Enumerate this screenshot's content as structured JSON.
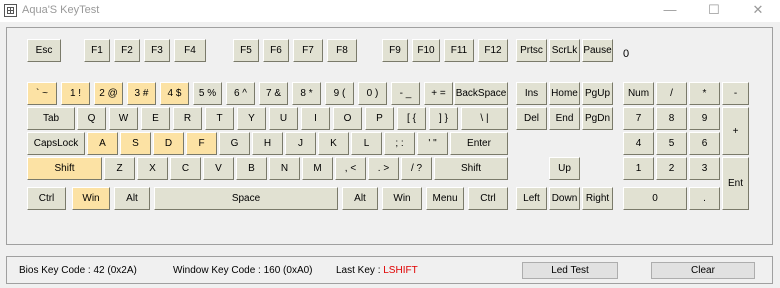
{
  "window": {
    "title": "Aqua'S KeyTest",
    "minimize": "—",
    "maximize": "☐",
    "close": "✕"
  },
  "bios_value": "0",
  "status": {
    "bios_label": "Bios Key Code : 42 (0x2A)",
    "window_label": "Window Key Code : 160 (0xA0)",
    "last_key_label": "Last Key : ",
    "last_key_value": "LSHIFT"
  },
  "buttons": {
    "led_test": "Led Test",
    "clear": "Clear"
  },
  "keys": [
    {
      "label": "Esc",
      "on": false
    },
    {
      "label": "F1",
      "on": false
    },
    {
      "label": "F2",
      "on": false
    },
    {
      "label": "F3",
      "on": false
    },
    {
      "label": "F4",
      "on": false
    },
    {
      "label": "F5",
      "on": false
    },
    {
      "label": "F6",
      "on": false
    },
    {
      "label": "F7",
      "on": false
    },
    {
      "label": "F8",
      "on": false
    },
    {
      "label": "F9",
      "on": false
    },
    {
      "label": "F10",
      "on": false
    },
    {
      "label": "F11",
      "on": false
    },
    {
      "label": "F12",
      "on": false
    },
    {
      "label": "Prtsc",
      "on": false
    },
    {
      "label": "ScrLk",
      "on": false
    },
    {
      "label": "Pause",
      "on": false
    },
    {
      "label": "` ~",
      "on": true
    },
    {
      "label": "1 !",
      "on": true
    },
    {
      "label": "2 @",
      "on": true
    },
    {
      "label": "3 #",
      "on": true
    },
    {
      "label": "4 $",
      "on": true
    },
    {
      "label": "5 %",
      "on": false
    },
    {
      "label": "6 ^",
      "on": false
    },
    {
      "label": "7 &",
      "on": false
    },
    {
      "label": "8 *",
      "on": false
    },
    {
      "label": "9 (",
      "on": false
    },
    {
      "label": "0 )",
      "on": false
    },
    {
      "label": "- _",
      "on": false
    },
    {
      "label": "+ =",
      "on": false
    },
    {
      "label": "BackSpace",
      "on": false
    },
    {
      "label": "Ins",
      "on": false
    },
    {
      "label": "Home",
      "on": false
    },
    {
      "label": "PgUp",
      "on": false
    },
    {
      "label": "Num",
      "on": false
    },
    {
      "label": "/",
      "on": false
    },
    {
      "label": "*",
      "on": false
    },
    {
      "label": "-",
      "on": false
    },
    {
      "label": "Tab",
      "on": false
    },
    {
      "label": "Q",
      "on": false
    },
    {
      "label": "W",
      "on": false
    },
    {
      "label": "E",
      "on": false
    },
    {
      "label": "R",
      "on": false
    },
    {
      "label": "T",
      "on": false
    },
    {
      "label": "Y",
      "on": false
    },
    {
      "label": "U",
      "on": false
    },
    {
      "label": "I",
      "on": false
    },
    {
      "label": "O",
      "on": false
    },
    {
      "label": "P",
      "on": false
    },
    {
      "label": "[ {",
      "on": false
    },
    {
      "label": "] }",
      "on": false
    },
    {
      "label": "\\ |",
      "on": false
    },
    {
      "label": "Del",
      "on": false
    },
    {
      "label": "End",
      "on": false
    },
    {
      "label": "PgDn",
      "on": false
    },
    {
      "label": "7",
      "on": false
    },
    {
      "label": "8",
      "on": false
    },
    {
      "label": "9",
      "on": false
    },
    {
      "label": "+",
      "on": false
    },
    {
      "label": "CapsLock",
      "on": false
    },
    {
      "label": "A",
      "on": true
    },
    {
      "label": "S",
      "on": true
    },
    {
      "label": "D",
      "on": true
    },
    {
      "label": "F",
      "on": true
    },
    {
      "label": "G",
      "on": false
    },
    {
      "label": "H",
      "on": false
    },
    {
      "label": "J",
      "on": false
    },
    {
      "label": "K",
      "on": false
    },
    {
      "label": "L",
      "on": false
    },
    {
      "label": "; :",
      "on": false
    },
    {
      "label": "' \"",
      "on": false
    },
    {
      "label": "Enter",
      "on": false
    },
    {
      "label": "4",
      "on": false
    },
    {
      "label": "5",
      "on": false
    },
    {
      "label": "6",
      "on": false
    },
    {
      "label": "Shift",
      "on": true
    },
    {
      "label": "Z",
      "on": false
    },
    {
      "label": "X",
      "on": false
    },
    {
      "label": "C",
      "on": false
    },
    {
      "label": "V",
      "on": false
    },
    {
      "label": "B",
      "on": false
    },
    {
      "label": "N",
      "on": false
    },
    {
      "label": "M",
      "on": false
    },
    {
      "label": ", <",
      "on": false
    },
    {
      "label": ". >",
      "on": false
    },
    {
      "label": "/ ?",
      "on": false
    },
    {
      "label": "Shift",
      "on": false
    },
    {
      "label": "Up",
      "on": false
    },
    {
      "label": "1",
      "on": false
    },
    {
      "label": "2",
      "on": false
    },
    {
      "label": "3",
      "on": false
    },
    {
      "label": "Ent",
      "on": false
    },
    {
      "label": "Ctrl",
      "on": false
    },
    {
      "label": "Win",
      "on": true
    },
    {
      "label": "Alt",
      "on": false
    },
    {
      "label": "Space",
      "on": false
    },
    {
      "label": "Alt",
      "on": false
    },
    {
      "label": "Win",
      "on": false
    },
    {
      "label": "Menu",
      "on": false
    },
    {
      "label": "Ctrl",
      "on": false
    },
    {
      "label": "Left",
      "on": false
    },
    {
      "label": "Down",
      "on": false
    },
    {
      "label": "Right",
      "on": false
    },
    {
      "label": "0",
      "on": false
    },
    {
      "label": ".",
      "on": false
    }
  ]
}
